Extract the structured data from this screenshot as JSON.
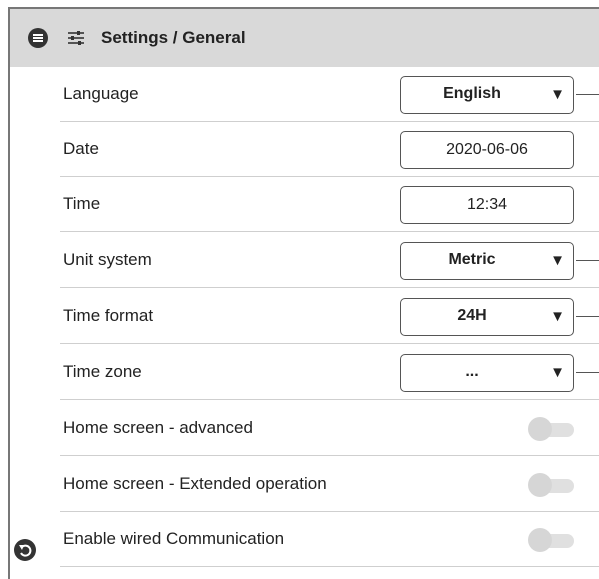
{
  "header": {
    "title": "Settings / General",
    "menu_icon": "menu-icon",
    "settings_icon": "sliders-icon"
  },
  "rows": [
    {
      "label": "Language",
      "control": "select",
      "value": "English"
    },
    {
      "label": "Date",
      "control": "input",
      "value": "2020-06-06"
    },
    {
      "label": "Time",
      "control": "input",
      "value": "12:34"
    },
    {
      "label": "Unit system",
      "control": "select",
      "value": "Metric"
    },
    {
      "label": "Time format",
      "control": "select",
      "value": "24H"
    },
    {
      "label": "Time zone",
      "control": "select",
      "value": "..."
    },
    {
      "label": "Home screen - advanced",
      "control": "toggle",
      "value": "off"
    },
    {
      "label": "Home screen - Extended operation",
      "control": "toggle",
      "value": "off"
    },
    {
      "label": "Enable wired Communication",
      "control": "toggle",
      "value": "off"
    }
  ],
  "select_arrow": "▼",
  "footer": {
    "back_icon": "back-icon"
  }
}
